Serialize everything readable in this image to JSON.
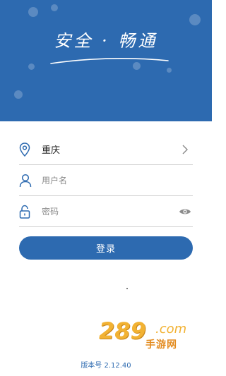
{
  "banner": {
    "slogan": "安全 · 畅通",
    "color": "#2d6ab0"
  },
  "form": {
    "city": {
      "icon": "location-pin-icon",
      "value": "重庆",
      "trail_icon": "chevron-right-icon"
    },
    "username": {
      "icon": "user-icon",
      "placeholder": "用户名"
    },
    "password": {
      "icon": "lock-icon",
      "placeholder": "密码",
      "trail_icon": "eye-icon"
    }
  },
  "login_button": {
    "label": "登录"
  },
  "watermark": {
    "number": "289",
    "domain": ".com",
    "text": "手游网"
  },
  "footer": {
    "version": "版本号 2.12.40"
  }
}
